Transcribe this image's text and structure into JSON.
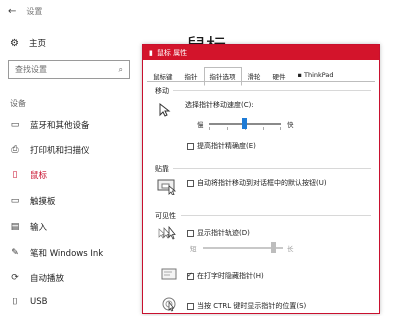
{
  "settings": {
    "back_title": "设置",
    "home_label": "主页",
    "search_placeholder": "查找设置",
    "section_label": "设备",
    "nav_items": [
      {
        "label": "蓝牙和其他设备",
        "icon": "bluetooth-devices-icon"
      },
      {
        "label": "打印机和扫描仪",
        "icon": "printer-icon"
      },
      {
        "label": "鼠标",
        "icon": "mouse-icon"
      },
      {
        "label": "触摸板",
        "icon": "touchpad-icon"
      },
      {
        "label": "输入",
        "icon": "keyboard-icon"
      },
      {
        "label": "笔和 Windows Ink",
        "icon": "pen-icon"
      },
      {
        "label": "自动播放",
        "icon": "autoplay-icon"
      },
      {
        "label": "USB",
        "icon": "usb-icon"
      }
    ],
    "active_item": "鼠标",
    "page_title": "鼠标"
  },
  "dialog": {
    "title": "鼠标 属性",
    "tabs": [
      "鼠标键",
      "指针",
      "指针选项",
      "滑轮",
      "硬件",
      "ThinkPad"
    ],
    "active_tab": "指针选项",
    "groups": {
      "motion": {
        "label": "移动",
        "speed_label": "选择指针移动速度(C):",
        "slow": "慢",
        "fast": "快",
        "precision_label": "提高指针精确度(E)",
        "precision_checked": false
      },
      "snap": {
        "label": "贴靠",
        "snap_label": "自动将指针移动到对话框中的默认按钮(U)",
        "snap_checked": false
      },
      "visibility": {
        "label": "可见性",
        "trails_label": "显示指针轨迹(D)",
        "trails_checked": false,
        "short": "短",
        "long": "长",
        "hide_label": "在打字时隐藏指针(H)",
        "hide_checked": true,
        "ctrl_label": "当按 CTRL 键时显示指针的位置(S)",
        "ctrl_checked": false
      }
    }
  },
  "colors": {
    "accent": "#d3142b",
    "slider": "#1e7bd6"
  }
}
